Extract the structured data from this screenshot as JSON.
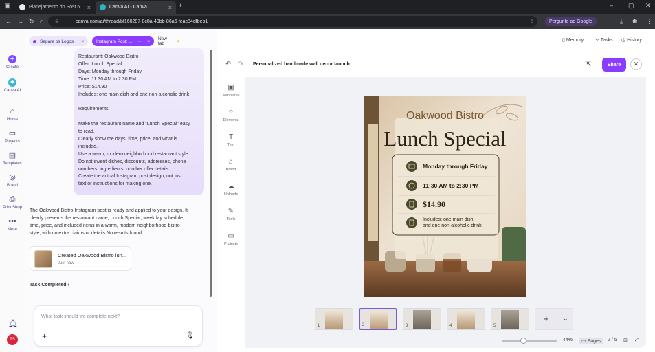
{
  "browser": {
    "tabs": [
      {
        "label": "Planejamento do Post 6"
      },
      {
        "label": "Canva AI - Canva"
      }
    ],
    "url_prefix": "canva.com/ai/thread/",
    "url": "canva.com/ai/thread/bf160287-8c8a-40bb-86a6-feac84dfbeb1",
    "google_button": "Pergunte ao Google"
  },
  "rail": {
    "items": [
      "Create",
      "Canva AI",
      "Home",
      "Projects",
      "Templates",
      "Brand",
      "Print Shop",
      "More"
    ],
    "avatar": "TS"
  },
  "chat": {
    "chips": [
      {
        "label": "Separe os Logos"
      },
      {
        "label": "Instagram Post: ..."
      },
      {
        "label": "New tab"
      }
    ],
    "user_message": [
      "Restaurant: Oakwood Bistro",
      "Offer: Lunch Special",
      "Days: Monday through Friday",
      "Time: 11:30 AM to 2:30 PM",
      "Price: $14.90",
      "Includes: one main dish and one non-alcoholic drink",
      "",
      "Requirements:",
      "",
      "Make the restaurant name and “Lunch Special” easy",
      "to read.",
      "Clearly show the days, time, price, and what is",
      "included.",
      "Use a warm, modern neighborhood restaurant style.",
      "Do not invent dishes, discounts, addresses, phone",
      "numbers, ingredients, or other offer details.",
      "Create the actual Instagram post design, not just",
      "text or instructions for making one."
    ],
    "agent_message": [
      "The Oakwood Bistro Instagram post is ready and applied to your design. It",
      "clearly presents the restaurant name, Lunch Special, weekday schedule,",
      "time, price, and included items in a warm, modern neighborhood-bistro",
      "style, with no extra claims or details.No results found."
    ],
    "result_card": {
      "title": "Created Oakwood Bistro lun...",
      "time": "Just now"
    },
    "task_completed": "Task Completed",
    "composer_placeholder": "What task should we complete next?"
  },
  "header_links": {
    "memory": "Memory",
    "tasks": "Tasks",
    "history": "History"
  },
  "editor": {
    "title": "Personalized handmade wall decor launch",
    "share": "Share",
    "tools": [
      "Templates",
      "Elements",
      "Text",
      "Brand",
      "Uploads",
      "Tools",
      "Projects"
    ],
    "pages": "Pages",
    "page_indicator": "2 / 5",
    "zoom": "44%",
    "thumb_numbers": [
      "1",
      "2",
      "3",
      "4",
      "5"
    ]
  },
  "design": {
    "restaurant": "Oakwood Bistro",
    "headline": "Lunch Special",
    "days": "Monday through Friday",
    "time": "11:30 AM to 2:30 PM",
    "price": "$14.90",
    "includes_line1": "Includes: one main dish",
    "includes_line2": "and one non-alcoholic drink"
  },
  "colors": {
    "accent": "#8b3dff",
    "brand_dark": "#4a3f2a",
    "poster_bg": "#e7dccb"
  }
}
